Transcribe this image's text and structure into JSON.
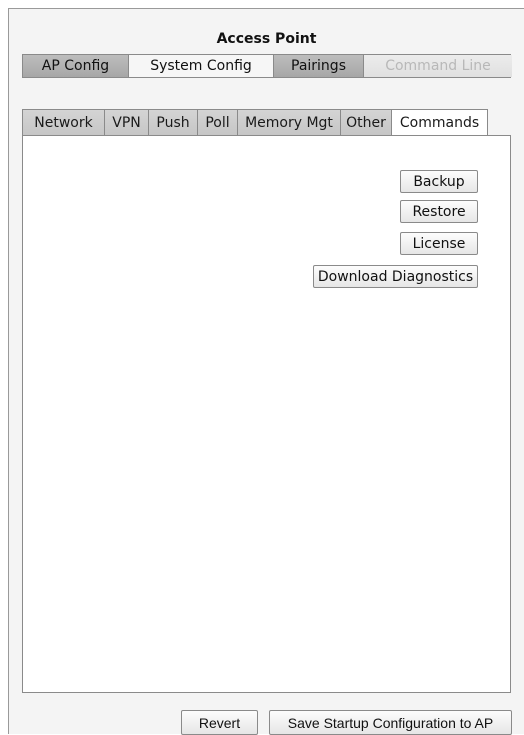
{
  "window": {
    "title": "Access Point"
  },
  "top_tabs": [
    {
      "label": "AP Config",
      "state": "normal"
    },
    {
      "label": "System Config",
      "state": "selected"
    },
    {
      "label": "Pairings",
      "state": "normal"
    },
    {
      "label": "Command Line",
      "state": "disabled"
    }
  ],
  "sub_tabs": [
    {
      "label": "Network"
    },
    {
      "label": "VPN"
    },
    {
      "label": "Push"
    },
    {
      "label": "Poll"
    },
    {
      "label": "Memory Mgt"
    },
    {
      "label": "Other"
    },
    {
      "label": "Commands",
      "active": true
    }
  ],
  "commands": {
    "backup_label": "Backup",
    "restore_label": "Restore",
    "license_label": "License",
    "download_diagnostics_label": "Download Diagnostics"
  },
  "footer": {
    "revert_label": "Revert",
    "save_label": "Save Startup Configuration to AP"
  }
}
